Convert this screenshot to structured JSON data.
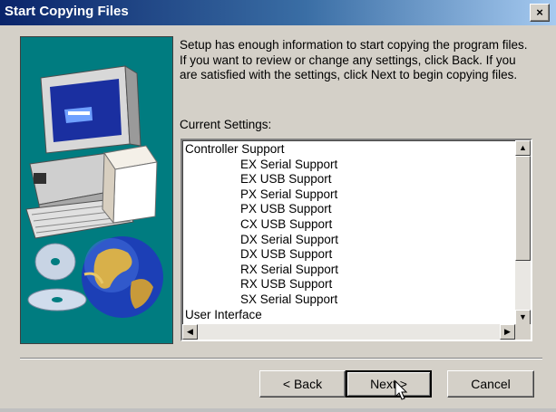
{
  "window": {
    "title": "Start Copying Files",
    "close_glyph": "×"
  },
  "intro_lines": [
    "Setup has enough information to start copying the program files.",
    "If you want to review or change any settings, click Back.  If you",
    "are satisfied with the settings, click Next to begin copying files."
  ],
  "current_settings_label": "Current Settings:",
  "settings": {
    "group1": "Controller Support",
    "items": [
      "EX Serial Support",
      "EX USB Support",
      "PX Serial Support",
      "PX USB Support",
      "CX USB Support",
      "DX Serial Support",
      "DX USB Support",
      "RX Serial Support",
      "RX USB Support",
      "SX Serial Support"
    ],
    "group2": "User Interface"
  },
  "buttons": {
    "back": "< Back",
    "next": "Next >",
    "cancel": "Cancel"
  },
  "icons": {
    "art": "computer-and-globe-illustration",
    "cursor": "mouse-pointer-icon"
  },
  "colors": {
    "title_start": "#0a246a",
    "title_end": "#a6caf0",
    "art_bg": "#007c80",
    "face": "#d4d0c8"
  }
}
